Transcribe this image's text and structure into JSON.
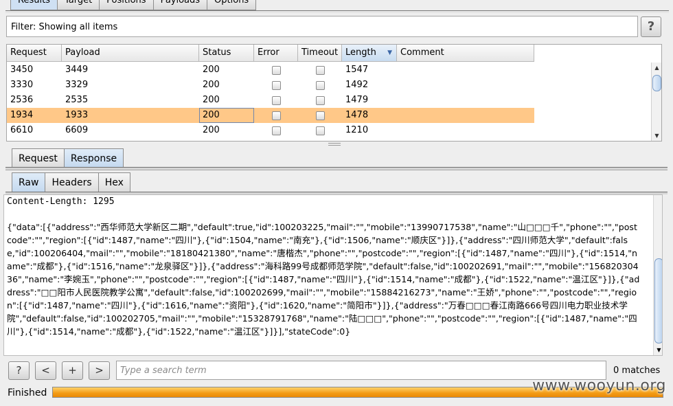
{
  "top_tabs": [
    "Results",
    "Target",
    "Positions",
    "Payloads",
    "Options"
  ],
  "filter": {
    "text": "Filter: Showing all items",
    "help": "?"
  },
  "table": {
    "columns": [
      {
        "label": "Request",
        "w": 80
      },
      {
        "label": "Payload",
        "w": 200
      },
      {
        "label": "Status",
        "w": 80
      },
      {
        "label": "Error",
        "w": 64
      },
      {
        "label": "Timeout",
        "w": 64
      },
      {
        "label": "Length",
        "w": 80,
        "sorted": true
      },
      {
        "label": "Comment",
        "w": 200
      }
    ],
    "rows": [
      {
        "request": "3450",
        "payload": "3449",
        "status": "200",
        "length": "1547",
        "selected": false
      },
      {
        "request": "3330",
        "payload": "3329",
        "status": "200",
        "length": "1492",
        "selected": false
      },
      {
        "request": "2536",
        "payload": "2535",
        "status": "200",
        "length": "1479",
        "selected": false
      },
      {
        "request": "1934",
        "payload": "1933",
        "status": "200",
        "length": "1478",
        "selected": true
      },
      {
        "request": "6610",
        "payload": "6609",
        "status": "200",
        "length": "1210",
        "selected": false
      }
    ]
  },
  "message_tabs": [
    "Request",
    "Response"
  ],
  "format_tabs": [
    "Raw",
    "Headers",
    "Hex"
  ],
  "editor": {
    "content_length": "Content-Length: 1295",
    "body": "{\"data\":[{\"address\":\"西华师范大学新区二期\",\"default\":true,\"id\":100203225,\"mail\":\"\",\"mobile\":\"13990717538\",\"name\":\"山□□□千\",\"phone\":\"\",\"postcode\":\"\",\"region\":[{\"id\":1487,\"name\":\"四川\"},{\"id\":1504,\"name\":\"南充\"},{\"id\":1506,\"name\":\"顺庆区\"}]},{\"address\":\"四川师范大学\",\"default\":false,\"id\":100206404,\"mail\":\"\",\"mobile\":\"18180421380\",\"name\":\"唐楷杰\",\"phone\":\"\",\"postcode\":\"\",\"region\":[{\"id\":1487,\"name\":\"四川\"},{\"id\":1514,\"name\":\"成都\"},{\"id\":1516,\"name\":\"龙泉驿区\"}]},{\"address\":\"海科路99号成都师范学院\",\"default\":false,\"id\":100202691,\"mail\":\"\",\"mobile\":\"15682030436\",\"name\":\"李婉玉\",\"phone\":\"\",\"postcode\":\"\",\"region\":[{\"id\":1487,\"name\":\"四川\"},{\"id\":1514,\"name\":\"成都\"},{\"id\":1522,\"name\":\"温江区\"}]},{\"address\":\"□□阳市人民医院教学公寓\",\"default\":false,\"id\":100202699,\"mail\":\"\",\"mobile\":\"15884216273\",\"name\":\"王娇\",\"phone\":\"\",\"postcode\":\"\",\"region\":[{\"id\":1487,\"name\":\"四川\"},{\"id\":1616,\"name\":\"资阳\"},{\"id\":1620,\"name\":\"简阳市\"}]},{\"address\":\"万春□□□春江南路666号四川电力职业技术学院\",\"default\":false,\"id\":100202705,\"mail\":\"\",\"mobile\":\"15328791768\",\"name\":\"陆□□□\",\"phone\":\"\",\"postcode\":\"\",\"region\":[{\"id\":1487,\"name\":\"四川\"},{\"id\":1514,\"name\":\"成都\"},{\"id\":1522,\"name\":\"温江区\"}]}],\"stateCode\":0}"
  },
  "search": {
    "placeholder": "Type a search term",
    "matches": "0 matches",
    "buttons": [
      "?",
      "<",
      "+",
      ">"
    ]
  },
  "status": {
    "text": "Finished",
    "progress": 1.0
  },
  "watermark": "www.wooyun.org"
}
